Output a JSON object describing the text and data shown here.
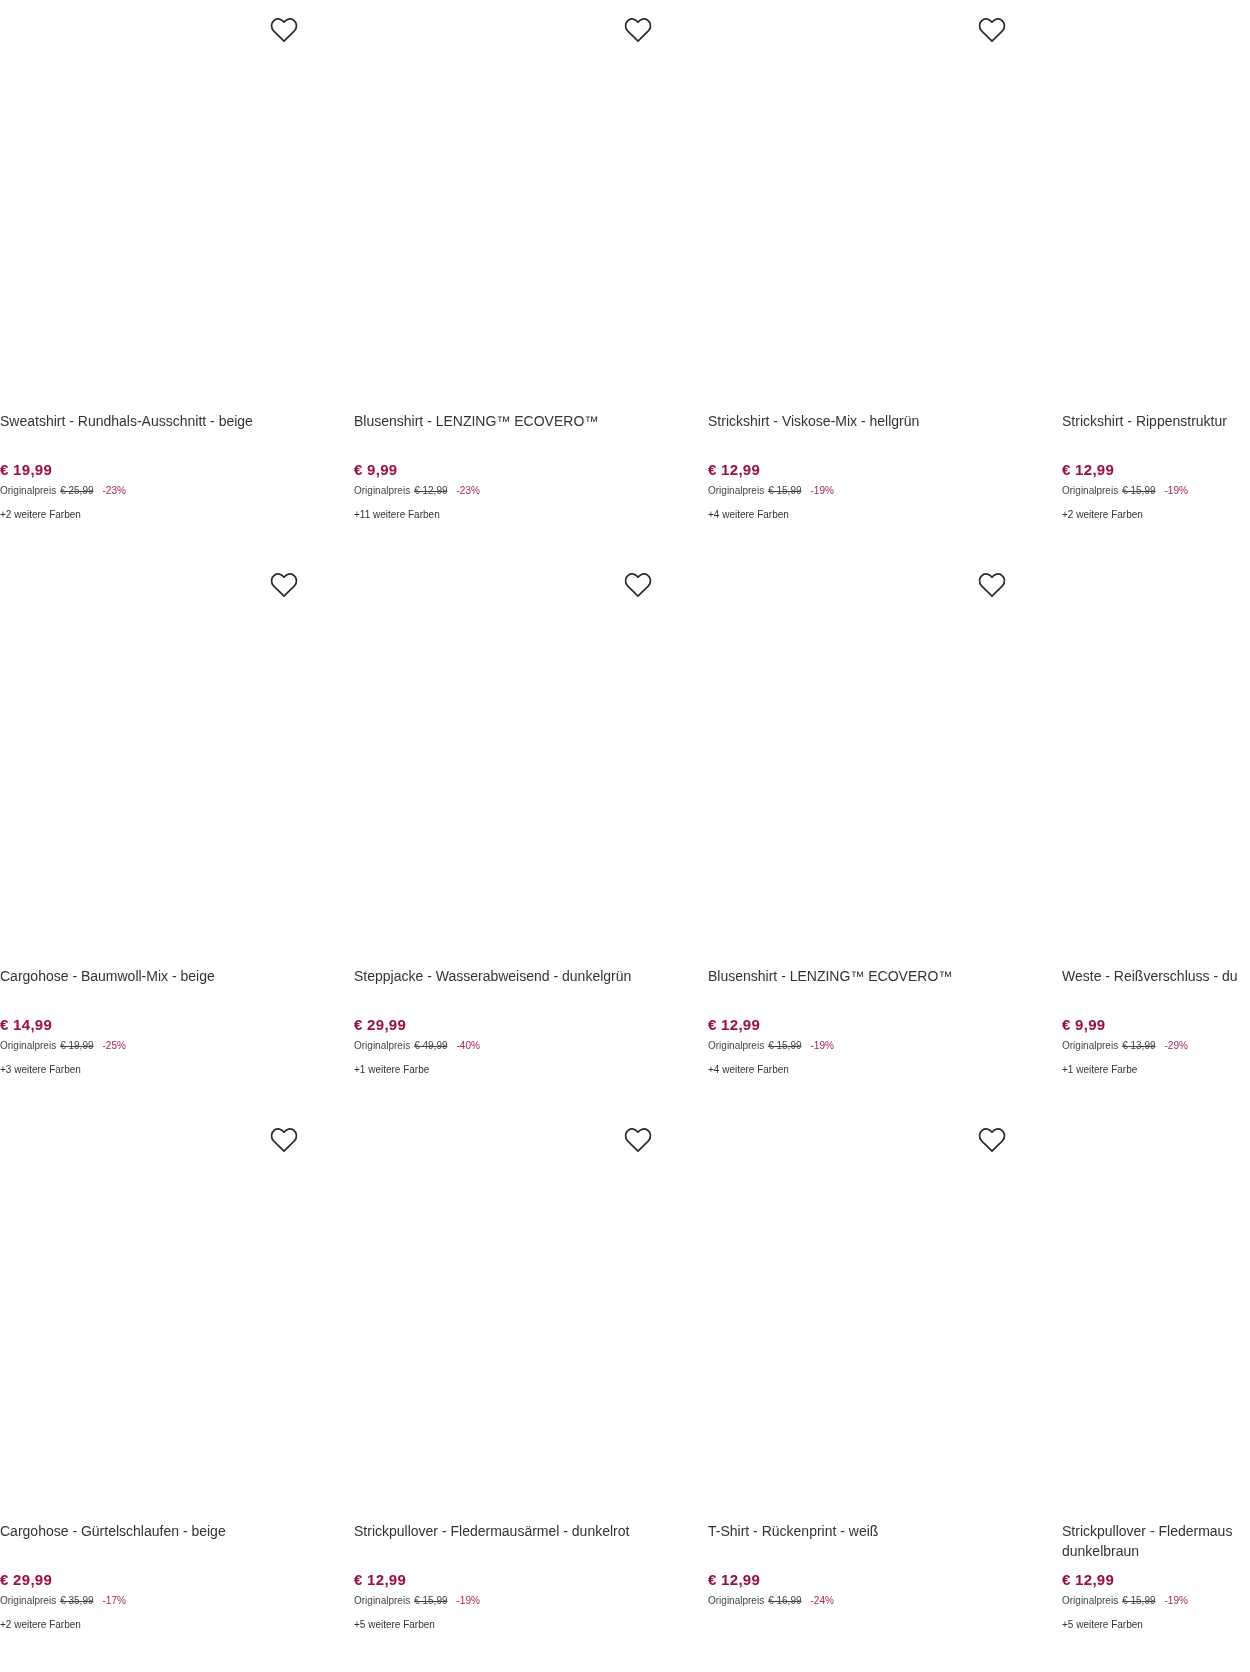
{
  "products": [
    {
      "title": "Sweatshirt - Rundhals-Ausschnitt - beige",
      "price": "€ 19,99",
      "original_label": "Originalpreis",
      "original_price": "€ 25,99",
      "discount": "-23%",
      "more_colors": "+2 weitere Farben",
      "wishlist_button": true
    },
    {
      "title": "Blusenshirt - LENZING™ ECOVERO™",
      "price": "€ 9,99",
      "original_label": "Originalpreis",
      "original_price": "€ 12,99",
      "discount": "-23%",
      "more_colors": "+11 weitere Farben",
      "wishlist_button": true
    },
    {
      "title": "Strickshirt - Viskose-Mix - hellgrün",
      "price": "€ 12,99",
      "original_label": "Originalpreis",
      "original_price": "€ 15,99",
      "discount": "-19%",
      "more_colors": "+4 weitere Farben",
      "wishlist_button": true
    },
    {
      "title": "Strickshirt - Rippenstruktur",
      "price": "€ 12,99",
      "original_label": "Originalpreis",
      "original_price": "€ 15,99",
      "discount": "-19%",
      "more_colors": "+2 weitere Farben",
      "wishlist_button": false
    },
    {
      "title": "Cargohose - Baumwoll-Mix - beige",
      "price": "€ 14,99",
      "original_label": "Originalpreis",
      "original_price": "€ 19,99",
      "discount": "-25%",
      "more_colors": "+3 weitere Farben",
      "wishlist_button": true
    },
    {
      "title": "Steppjacke - Wasserabweisend - dunkelgrün",
      "price": "€ 29,99",
      "original_label": "Originalpreis",
      "original_price": "€ 49,99",
      "discount": "-40%",
      "more_colors": "+1 weitere Farbe",
      "wishlist_button": true
    },
    {
      "title": "Blusenshirt - LENZING™ ECOVERO™",
      "price": "€ 12,99",
      "original_label": "Originalpreis",
      "original_price": "€ 15,99",
      "discount": "-19%",
      "more_colors": "+4 weitere Farben",
      "wishlist_button": true
    },
    {
      "title": "Weste - Reißverschluss - du",
      "price": "€ 9,99",
      "original_label": "Originalpreis",
      "original_price": "€ 13,99",
      "discount": "-29%",
      "more_colors": "+1 weitere Farbe",
      "wishlist_button": false
    },
    {
      "title": "Cargohose - Gürtelschlaufen - beige",
      "price": "€ 29,99",
      "original_label": "Originalpreis",
      "original_price": "€ 35,99",
      "discount": "-17%",
      "more_colors": "+2 weitere Farben",
      "wishlist_button": true
    },
    {
      "title": "Strickpullover - Fledermausärmel - dunkelrot",
      "price": "€ 12,99",
      "original_label": "Originalpreis",
      "original_price": "€ 15,99",
      "discount": "-19%",
      "more_colors": "+5 weitere Farben",
      "wishlist_button": true
    },
    {
      "title": "T-Shirt - Rückenprint - weiß",
      "price": "€ 12,99",
      "original_label": "Originalpreis",
      "original_price": "€ 16,99",
      "discount": "-24%",
      "wishlist_button": true
    },
    {
      "title": "Strickpullover - Fledermaus dunkelbraun",
      "price": "€ 12,99",
      "original_label": "Originalpreis",
      "original_price": "€ 15,99",
      "discount": "-19%",
      "more_colors": "+5 weitere Farben",
      "wishlist_button": false
    }
  ]
}
